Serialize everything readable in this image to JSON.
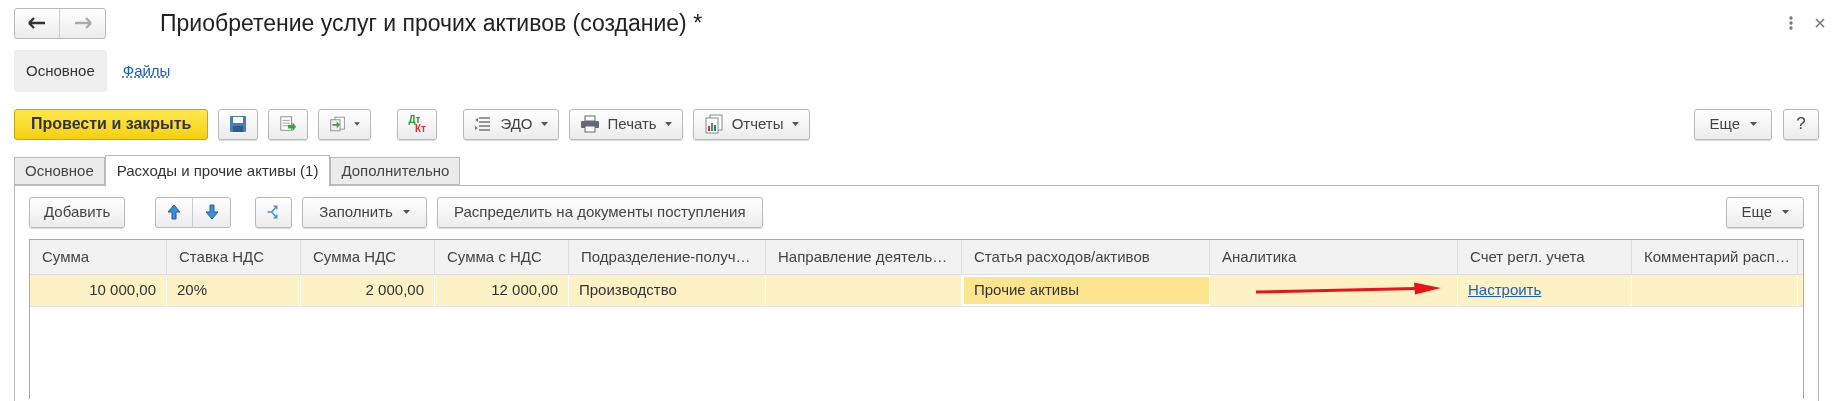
{
  "window": {
    "title": "Приобретение услуг и прочих активов (создание) *"
  },
  "sections": [
    {
      "label": "Основное",
      "selected": true
    },
    {
      "label": "Файлы",
      "selected": false
    }
  ],
  "toolbar": [
    {
      "kind": "primary",
      "label": "Провести и закрыть"
    },
    {
      "kind": "save"
    },
    {
      "kind": "post"
    },
    {
      "kind": "create"
    },
    {
      "kind": "dtkt",
      "label": "Дт",
      "label2": "Кт"
    },
    {
      "kind": "edo",
      "label": "ЭДО"
    },
    {
      "kind": "print",
      "label": "Печать"
    },
    {
      "kind": "report",
      "label": "Отчеты"
    }
  ],
  "toolbar_right": {
    "more": "Еще",
    "help": "?"
  },
  "tabs": [
    {
      "label": "Основное",
      "selected": false
    },
    {
      "label": "Расходы и прочие активы (1)",
      "selected": true
    },
    {
      "label": "Дополнительно",
      "selected": false
    }
  ],
  "table_toolbar": {
    "add": "Добавить",
    "fill": "Заполнить",
    "distribute": "Распределить на документы поступления",
    "more": "Еще"
  },
  "table": {
    "columns": [
      "Сумма",
      "Ставка НДС",
      "Сумма НДС",
      "Сумма с НДС",
      "Подразделение-получ…",
      "Направление деятель…",
      "Статья расходов/активов",
      "Аналитика",
      "Счет регл. учета",
      "Комментарий расп…"
    ],
    "rows": [
      {
        "selected": true,
        "cells": [
          {
            "kind": "number",
            "text": "10 000,00",
            "focused": false
          },
          {
            "kind": "text",
            "text": "20%",
            "focused": false
          },
          {
            "kind": "number",
            "text": "2 000,00",
            "focused": false
          },
          {
            "kind": "number",
            "text": "12 000,00",
            "focused": false
          },
          {
            "kind": "text",
            "text": "Производство",
            "focused": false
          },
          {
            "kind": "text",
            "focused": false
          },
          {
            "kind": "text",
            "text": "Прочие активы",
            "focused": true
          },
          {
            "kind": "text",
            "focused": false
          },
          {
            "kind": "link",
            "text": "Настроить",
            "focused": false
          },
          {
            "kind": "text",
            "focused": false
          }
        ]
      }
    ]
  }
}
